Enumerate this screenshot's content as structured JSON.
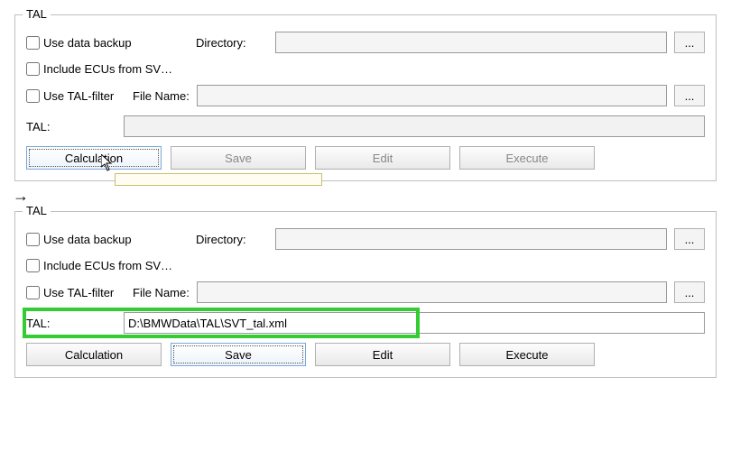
{
  "arrow": "→",
  "top": {
    "legend": "TAL",
    "use_data_backup": "Use data backup",
    "directory_label": "Directory:",
    "directory_value": "",
    "include_ecus": "Include ECUs from SV…",
    "use_tal_filter": "Use TAL-filter",
    "file_name_label": "File Name:",
    "file_name_value": "",
    "tal_label": "TAL:",
    "tal_value": "",
    "browse": "...",
    "buttons": {
      "calculation": "Calculation",
      "save": "Save",
      "edit": "Edit",
      "execute": "Execute"
    }
  },
  "bottom": {
    "legend": "TAL",
    "use_data_backup": "Use data backup",
    "directory_label": "Directory:",
    "directory_value": "",
    "include_ecus": "Include ECUs from SV…",
    "use_tal_filter": "Use TAL-filter",
    "file_name_label": "File Name:",
    "file_name_value": "",
    "tal_label": "TAL:",
    "tal_value": "D:\\BMWData\\TAL\\SVT_tal.xml",
    "browse": "...",
    "buttons": {
      "calculation": "Calculation",
      "save": "Save",
      "edit": "Edit",
      "execute": "Execute"
    }
  }
}
